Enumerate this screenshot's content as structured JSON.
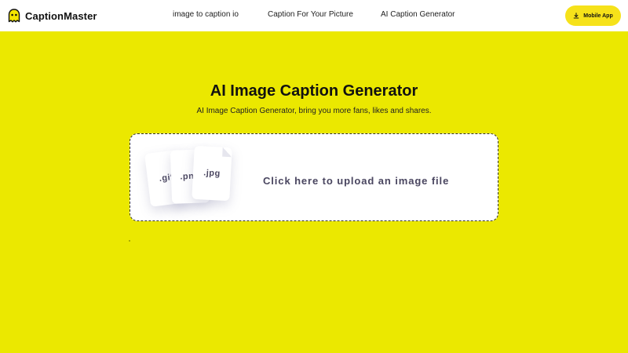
{
  "header": {
    "logo_text": "CaptionMaster",
    "logo_icon": "ghost-icon",
    "nav": [
      {
        "label": "image to caption io"
      },
      {
        "label": "Caption For Your Picture"
      },
      {
        "label": "AI Caption Generator"
      }
    ],
    "app_button": {
      "label": "Mobile App",
      "icon": "download-icon"
    }
  },
  "hero": {
    "title": "AI Image Caption Generator",
    "subtitle": "AI Image Caption Generator, bring you more fans, likes and shares."
  },
  "upload": {
    "file_types": [
      ".gif",
      ".png",
      ".jpg"
    ],
    "label": "Click here to upload an image file"
  },
  "colors": {
    "page_background": "#ebe800",
    "button_background": "#f6e21a",
    "upload_text": "#4a4660"
  }
}
